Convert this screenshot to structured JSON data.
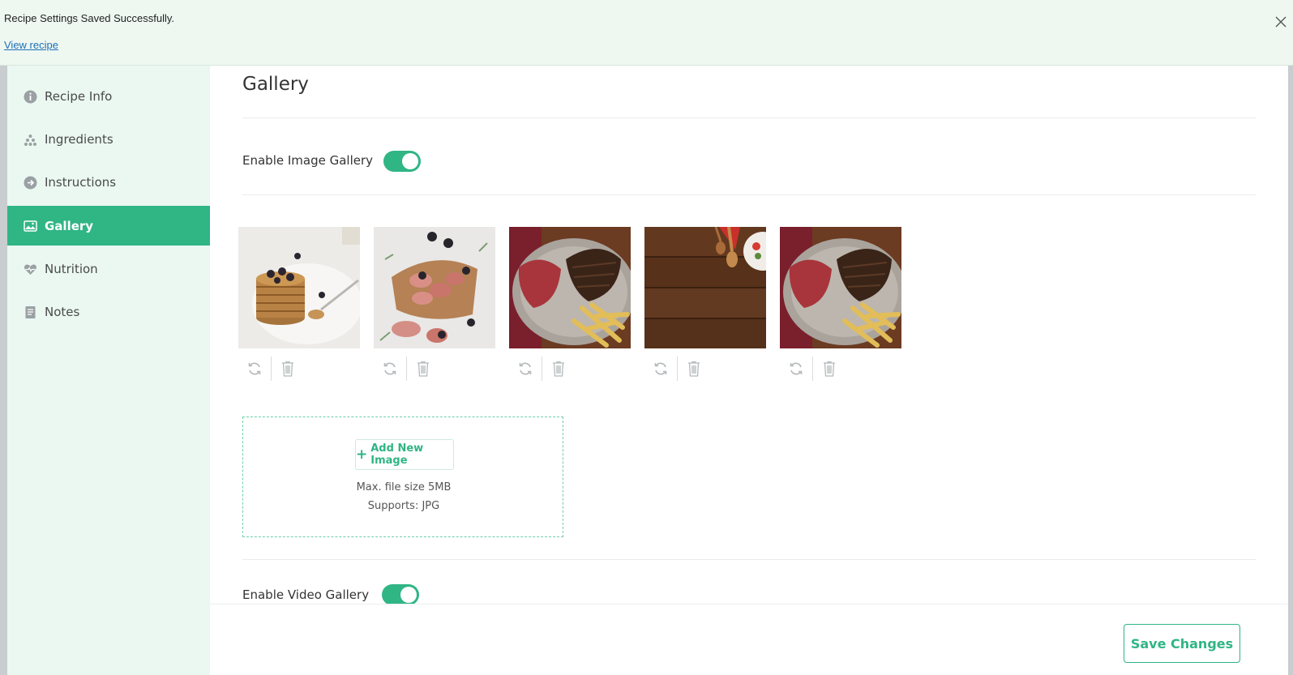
{
  "notice": {
    "message": "Recipe Settings Saved Successfully.",
    "link": "View recipe"
  },
  "sidebar": {
    "items": [
      {
        "label": "Recipe Info",
        "icon": "info-icon"
      },
      {
        "label": "Ingredients",
        "icon": "ingredients-icon"
      },
      {
        "label": "Instructions",
        "icon": "arrow-right-circle-icon"
      },
      {
        "label": "Gallery",
        "icon": "gallery-icon",
        "active": true
      },
      {
        "label": "Nutrition",
        "icon": "heart-pulse-icon"
      },
      {
        "label": "Notes",
        "icon": "notes-icon"
      }
    ]
  },
  "main": {
    "title": "Gallery",
    "image_gallery": {
      "label": "Enable Image Gallery",
      "enabled": true,
      "images": [
        {
          "subject": "pancakes"
        },
        {
          "subject": "bacon-wrapped-bites"
        },
        {
          "subject": "steak-and-fries"
        },
        {
          "subject": "wooden-table"
        },
        {
          "subject": "steak-and-fries"
        }
      ]
    },
    "upload": {
      "button_label": "Add New Image",
      "max_size": "Max. file size 5MB",
      "supports": "Supports: JPG"
    },
    "video_gallery": {
      "label": "Enable Video Gallery",
      "enabled": true
    }
  },
  "footer": {
    "save_label": "Save Changes"
  },
  "colors": {
    "accent": "#30b585",
    "sidebar_bg": "#eaf8f1",
    "notice_bg": "#eef8f1"
  }
}
